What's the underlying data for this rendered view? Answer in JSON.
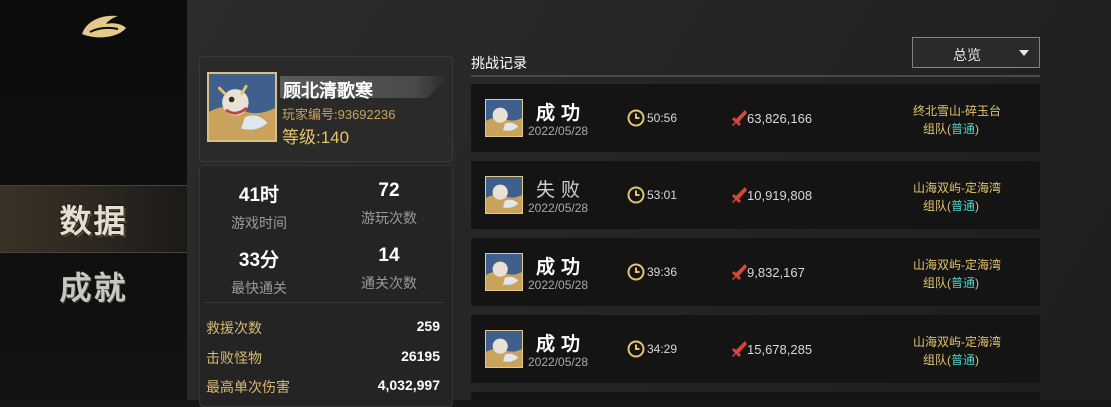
{
  "nav": {
    "items": [
      {
        "label": "数据",
        "active": true
      },
      {
        "label": "成就",
        "active": false
      }
    ]
  },
  "profile": {
    "name": "顾北清歌寒",
    "id_text": "玩家编号:93692236",
    "level_text": "等级:140"
  },
  "stats": {
    "cells": [
      {
        "value": "41时",
        "label": "游戏时间"
      },
      {
        "value": "72",
        "label": "游玩次数"
      },
      {
        "value": "33分",
        "label": "最快通关"
      },
      {
        "value": "14",
        "label": "通关次数"
      }
    ],
    "rows": [
      {
        "key": "救援次数",
        "value": "259"
      },
      {
        "key": "击败怪物",
        "value": "26195"
      },
      {
        "key": "最高单次伤害",
        "value": "4,032,997"
      }
    ]
  },
  "records": {
    "title": "挑战记录",
    "filter": "总览",
    "items": [
      {
        "result": "成功",
        "date": "2022/05/28",
        "time": "50:56",
        "damage": "63,826,166",
        "map": "终北雪山-碎玉台",
        "mode": "组队",
        "difficulty": "普通"
      },
      {
        "result": "失败",
        "date": "2022/05/28",
        "time": "53:01",
        "damage": "10,919,808",
        "map": "山海双屿-定海湾",
        "mode": "组队",
        "difficulty": "普通"
      },
      {
        "result": "成功",
        "date": "2022/05/28",
        "time": "39:36",
        "damage": "9,832,167",
        "map": "山海双屿-定海湾",
        "mode": "组队",
        "difficulty": "普通"
      },
      {
        "result": "成功",
        "date": "2022/05/28",
        "time": "34:29",
        "damage": "15,678,285",
        "map": "山海双屿-定海湾",
        "mode": "组队",
        "difficulty": "普通"
      }
    ]
  },
  "colors": {
    "accent_gold": "#e4c46c",
    "difficulty_teal": "#4fd0c8",
    "damage_red": "#d8453a"
  }
}
